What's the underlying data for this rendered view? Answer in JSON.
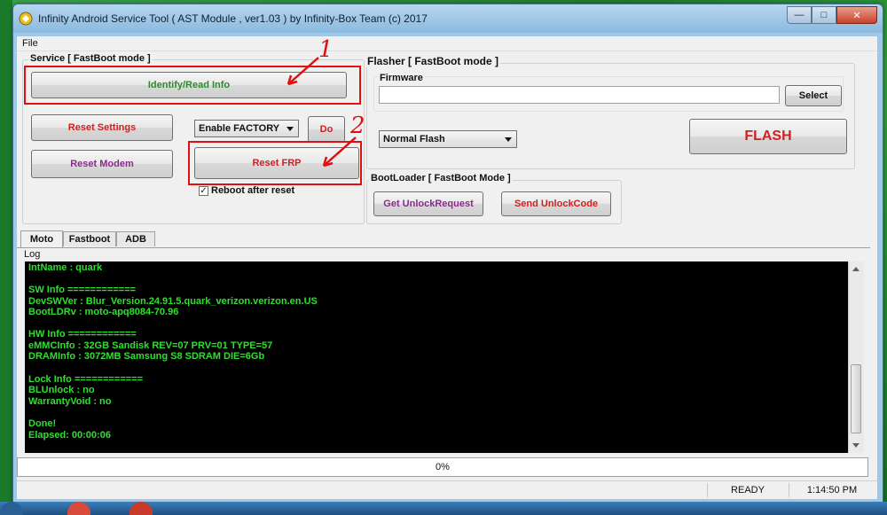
{
  "window": {
    "title": "Infinity Android Service Tool ( AST Module , ver1.03  ) by Infinity-Box Team (c) 2017",
    "menu": [
      "File"
    ]
  },
  "service": {
    "group_title": "Service [ FastBoot mode ]",
    "identify_label": "Identify/Read Info",
    "reset_settings_label": "Reset Settings",
    "reset_modem_label": "Reset Modem",
    "factory_select_value": "Enable FACTORY",
    "do_label": "Do",
    "reset_frp_label": "Reset FRP",
    "reboot_checkbox_label": "Reboot after reset",
    "reboot_checked": true
  },
  "flasher": {
    "group_title": "Flasher [ FastBoot mode ]",
    "firmware_label": "Firmware",
    "firmware_value": "",
    "select_label": "Select",
    "flash_mode_value": "Normal Flash",
    "flash_label": "FLASH"
  },
  "bootloader": {
    "group_title": "BootLoader [ FastBoot Mode ]",
    "unlock_request_label": "Get UnlockRequest",
    "send_unlock_label": "Send UnlockCode"
  },
  "annotations": [
    "1",
    "2"
  ],
  "tabs": [
    "Moto",
    "Fastboot",
    "ADB"
  ],
  "active_tab": "Moto",
  "log": {
    "label": "Log",
    "lines": [
      "IntName  : quark",
      "",
      "SW Info ============",
      "DevSWVer : Blur_Version.24.91.5.quark_verizon.verizon.en.US",
      "BootLDRv : moto-apq8084-70.96",
      "",
      "HW Info ============",
      "eMMCInfo : 32GB Sandisk REV=07 PRV=01 TYPE=57",
      "DRAMInfo : 3072MB Samsung S8 SDRAM DIE=6Gb",
      "",
      "Lock Info ============",
      "BLUnlock : no",
      "WarrantyVoid : no",
      "",
      "Done!",
      "Elapsed: 00:00:06"
    ]
  },
  "progress": {
    "text": "0%",
    "value": 0
  },
  "status": {
    "state": "READY",
    "time": "1:14:50 PM"
  },
  "colors": {
    "green_text": "#2d8a2d",
    "red_text": "#d02020",
    "purple_text": "#8a2a8a",
    "console_text": "#2ee02e",
    "annotation": "#e01010"
  }
}
